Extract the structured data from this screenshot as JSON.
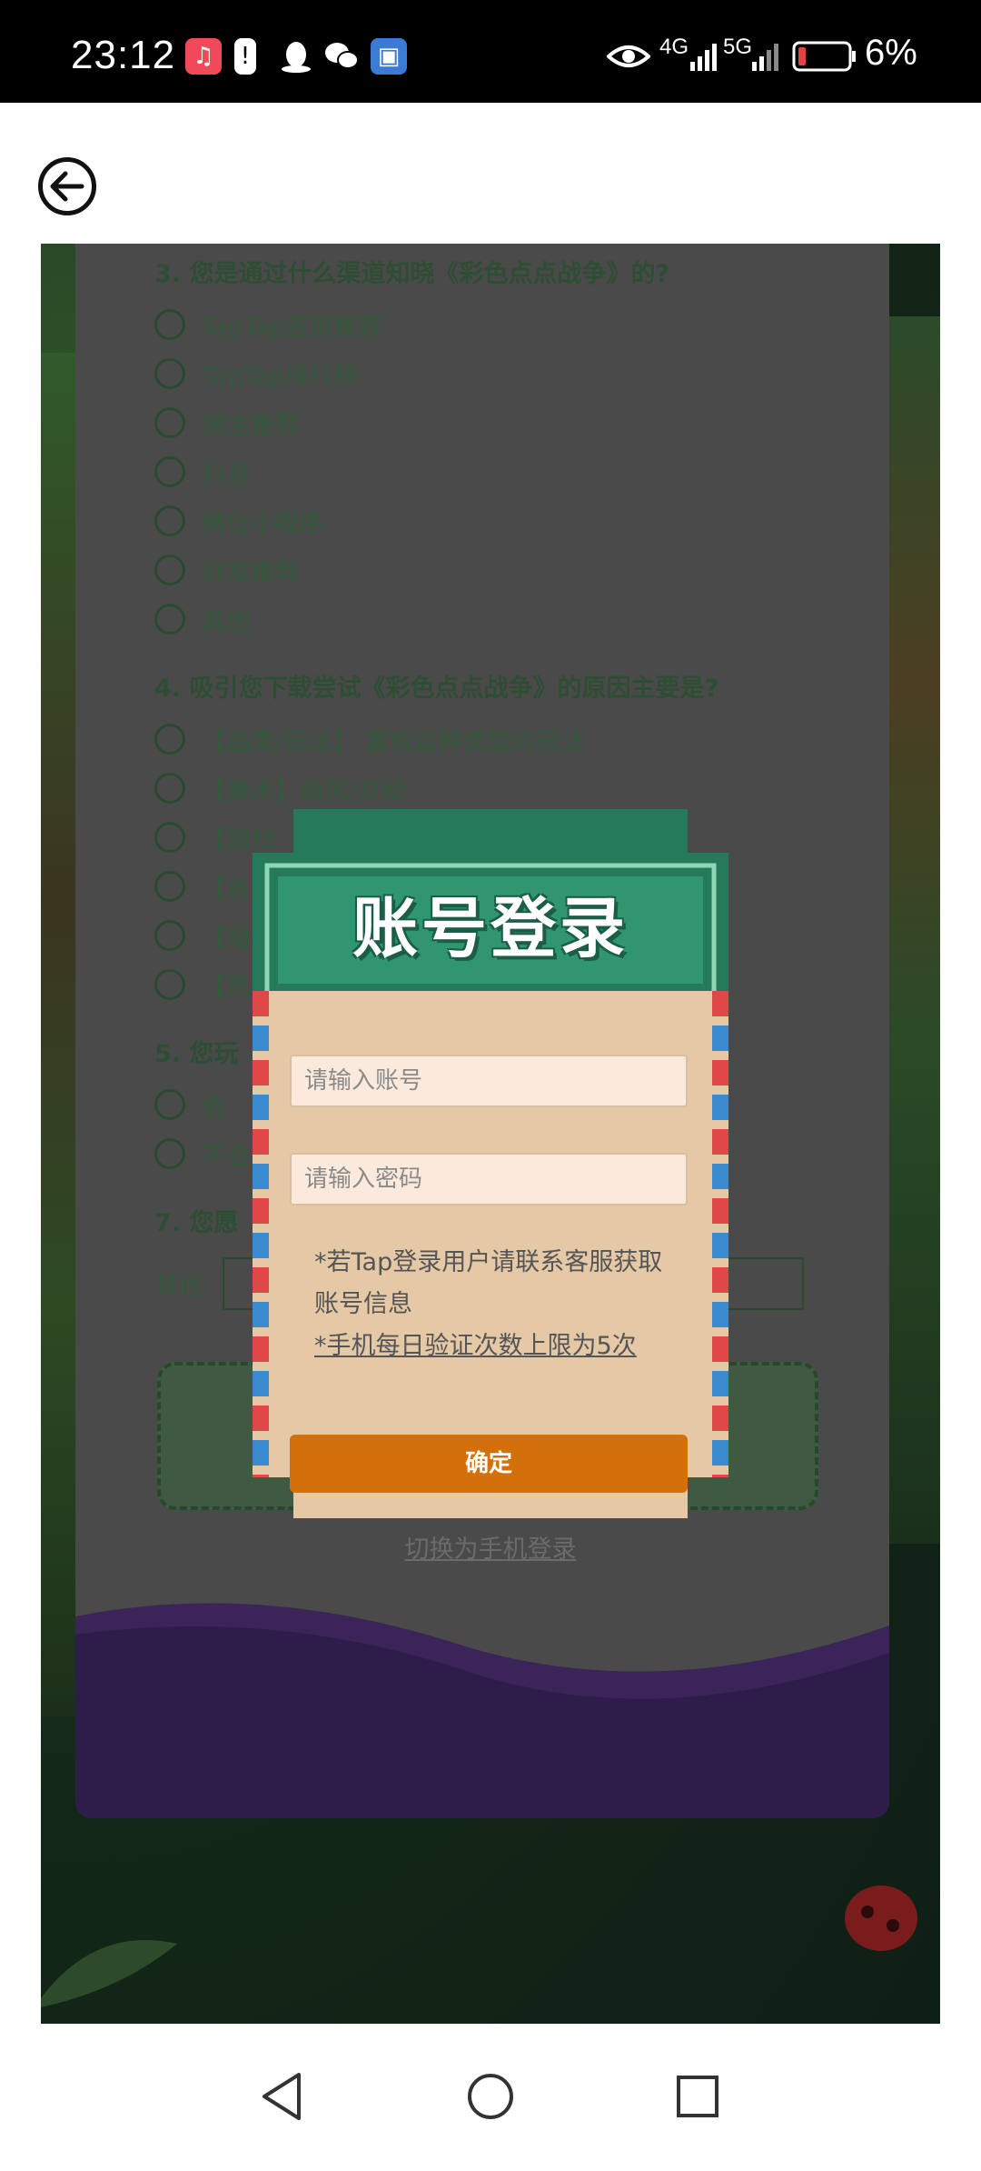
{
  "status_bar": {
    "time": "23:12",
    "network_4g": "4G",
    "network_5g": "5G",
    "battery": "6%",
    "icons": [
      "music-icon",
      "alert-icon",
      "qq-icon",
      "wechat-icon",
      "app-icon",
      "eye-icon",
      "signal-icon",
      "battery-icon"
    ]
  },
  "app_bar": {
    "back_icon": "back-arrow-icon"
  },
  "survey": {
    "q3": {
      "title": "3. 您是通过什么渠道知晓《彩色点点战争》的?",
      "options": [
        "TapTap首页推荐",
        "TapTap排行榜",
        "博主推荐",
        "抖音",
        "微信小程序",
        "好友推荐",
        "其他"
      ]
    },
    "q4": {
      "title": "4. 吸引您下载尝试《彩色点点战争》的原因主要是?",
      "options": [
        "【品类/玩法】 喜欢这种类型的玩法",
        "【美术】画风/立绘",
        "【题材",
        "【各",
        "【福",
        "【热"
      ]
    },
    "q5": {
      "title": "5. 您玩",
      "options": [
        "会",
        "不会"
      ]
    },
    "q7": {
      "title": "7. 您愿"
    },
    "other_label": "其他:"
  },
  "login_modal": {
    "title": "账号登录",
    "account_placeholder": "请输入账号",
    "password_placeholder": "请输入密码",
    "note": "*若Tap登录用户请联系客服获取账号信息",
    "note_limit": "*手机每日验证次数上限为5次",
    "confirm_label": "确定",
    "switch_label": "切换为手机登录"
  },
  "colors": {
    "title_green": "#247a5a",
    "confirm_orange": "#d4700a",
    "ticket_body": "#e5c8a6",
    "stripe_red": "#e04848",
    "stripe_blue": "#3a8ad0"
  }
}
